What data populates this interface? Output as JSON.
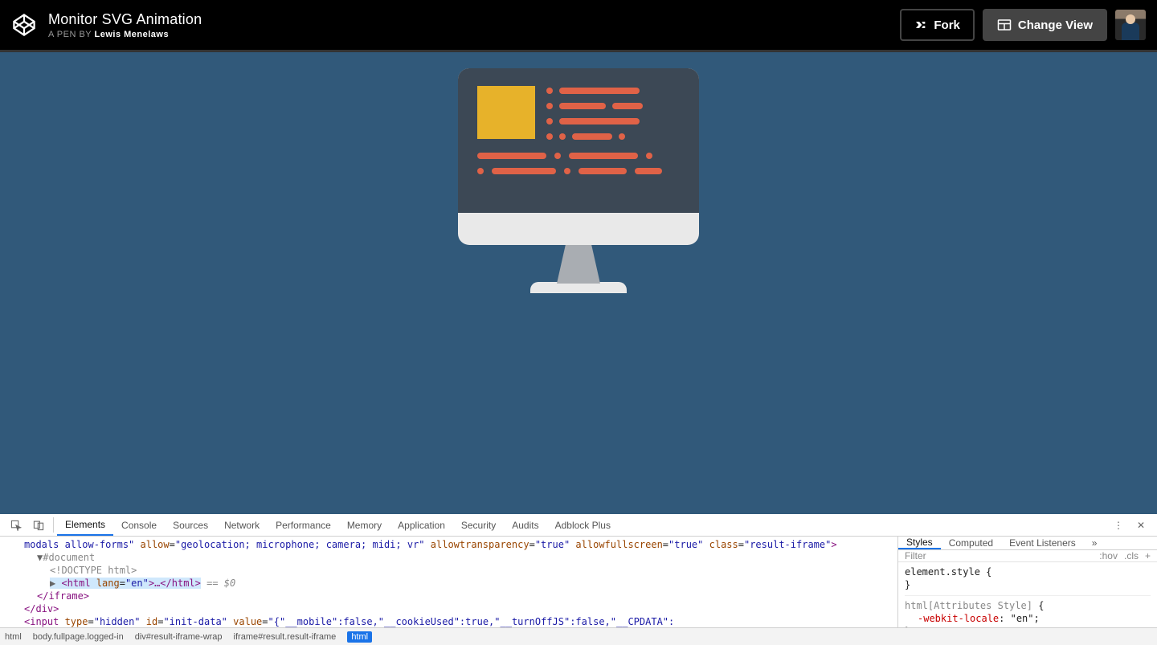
{
  "header": {
    "title": "Monitor SVG Animation",
    "byline_prefix": "A PEN BY",
    "author": "Lewis Menelaws",
    "fork_label": "Fork",
    "change_view_label": "Change View"
  },
  "devtools": {
    "tabs": [
      "Elements",
      "Console",
      "Sources",
      "Network",
      "Performance",
      "Memory",
      "Application",
      "Security",
      "Audits",
      "Adblock Plus"
    ],
    "active_tab": "Elements",
    "elements": {
      "line1_part1": "modals allow-forms\" ",
      "line1_allow_attr": "allow",
      "line1_allow_val": "\"geolocation; microphone; camera; midi; vr\"",
      "line1_at_attr": "allowtransparency",
      "line1_at_val": "\"true\"",
      "line1_af_attr": "allowfullscreen",
      "line1_af_val": "\"true\"",
      "line1_class_attr": "class",
      "line1_class_val": "\"result-iframe\"",
      "line1_end": ">",
      "line2": "#document",
      "line3": "<!DOCTYPE html>",
      "line4_open": "<html ",
      "line4_attr": "lang",
      "line4_val": "\"en\"",
      "line4_mid": ">…</html>",
      "line4_note": " == $0",
      "line5": "</iframe>",
      "line6": "</div>",
      "line7_open": "<input ",
      "line7_type_attr": "type",
      "line7_type_val": "\"hidden\"",
      "line7_id_attr": "id",
      "line7_id_val": "\"init-data\"",
      "line7_value_attr": "value",
      "line7_value_val": "\"{\"__mobile\":false,\"__cookieUsed\":true,\"__turnOffJS\":false,\"__CPDATA\":{\"domain\":\"https://codepen.io\",\"domain_iframe\":"
    },
    "styles": {
      "tabs": [
        "Styles",
        "Computed",
        "Event Listeners"
      ],
      "active_tab": "Styles",
      "filter_placeholder": "Filter",
      "hov_label": ":hov",
      "cls_label": ".cls",
      "rule1_selector": "element.style",
      "rule1_body": "{",
      "rule1_close": "}",
      "rule2_selector": "html[Attributes Style]",
      "rule2_body": "{",
      "rule2_prop": "-webkit-locale",
      "rule2_val": ": \"en\";",
      "rule2_close": "}"
    },
    "breadcrumbs": [
      "html",
      "body.fullpage.logged-in",
      "div#result-iframe-wrap",
      "iframe#result.result-iframe",
      "html"
    ]
  }
}
